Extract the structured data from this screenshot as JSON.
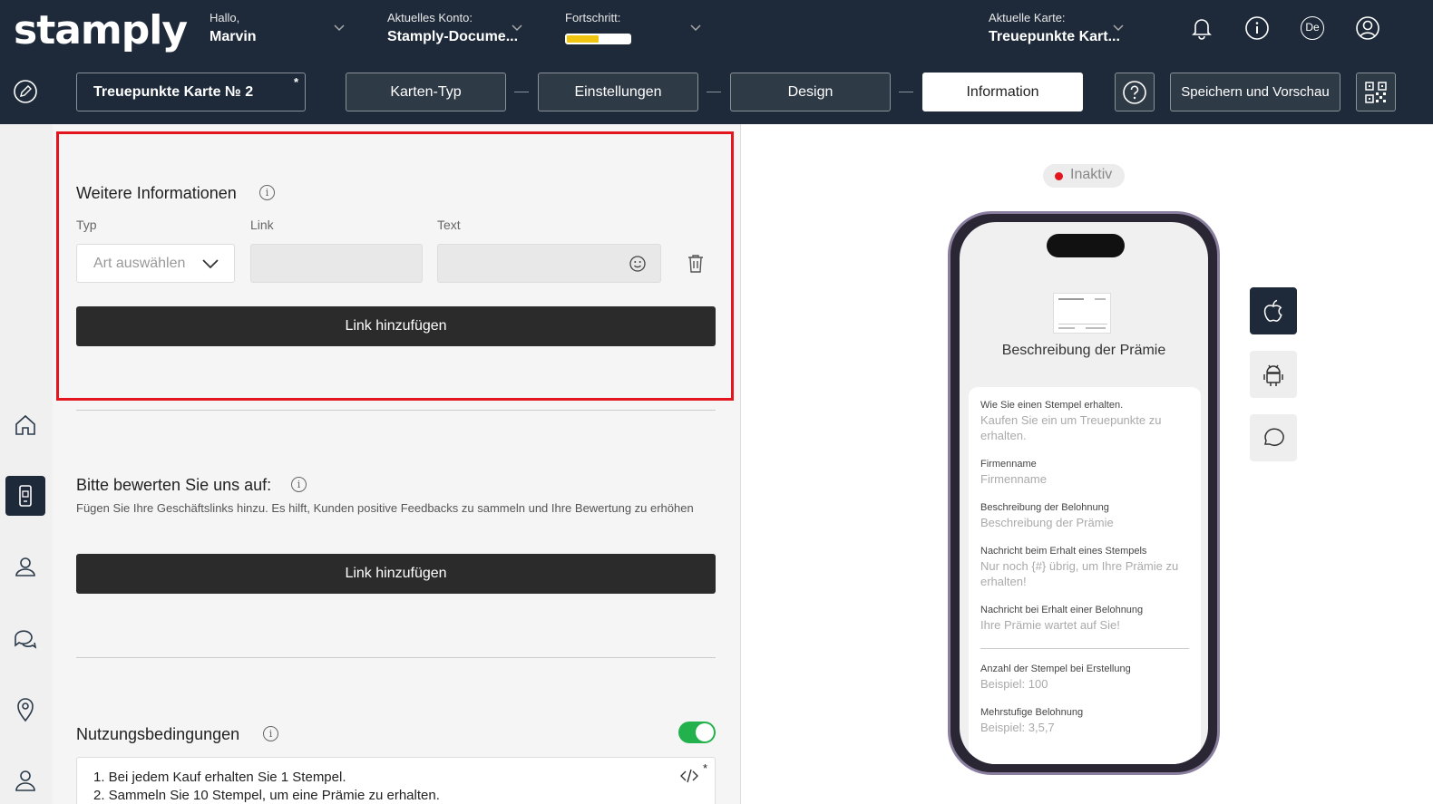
{
  "header": {
    "logo": "stamply",
    "greeting_label": "Hallo,",
    "greeting_name": "Marvin",
    "account_label": "Aktuelles Konto:",
    "account_value": "Stamply-Docume...",
    "progress_label": "Fortschritt:",
    "progress_fraction": 0.5,
    "card_label": "Aktuelle Karte:",
    "card_value": "Treuepunkte Kart...",
    "language": "De"
  },
  "toolbar": {
    "card_name": "Treuepunkte Karte № 2",
    "card_name_marker": "*",
    "steps": [
      "Karten-Typ",
      "Einstellungen",
      "Design",
      "Information"
    ],
    "active_step": "Information",
    "save_label": "Speichern und Vorschau"
  },
  "info_section": {
    "title": "Weitere Informationen",
    "info_glyph": "i",
    "type_label": "Typ",
    "link_label": "Link",
    "text_label": "Text",
    "type_placeholder": "Art auswählen",
    "add_link_label": "Link hinzufügen"
  },
  "review_section": {
    "title": "Bitte bewerten Sie uns auf:",
    "description": "Fügen Sie Ihre Geschäftslinks hinzu. Es hilft, Kunden positive Feedbacks zu sammeln und Ihre Bewertung zu erhöhen",
    "add_link_label": "Link hinzufügen"
  },
  "terms_section": {
    "title": "Nutzungsbedingungen",
    "enabled": true,
    "code_marker": "*",
    "lines": [
      "1. Bei jedem Kauf erhalten Sie 1 Stempel.",
      "2. Sammeln Sie 10 Stempel, um eine Prämie zu erhalten."
    ]
  },
  "preview": {
    "status": "Inaktiv",
    "title": "Beschreibung der Prämie",
    "fields": [
      {
        "label": "Wie Sie einen Stempel erhalten.",
        "value": "Kaufen Sie ein um Treuepunkte zu erhalten."
      },
      {
        "label": "Firmenname",
        "value": "Firmenname"
      },
      {
        "label": "Beschreibung der Belohnung",
        "value": "Beschreibung der Prämie"
      },
      {
        "label": "Nachricht beim Erhalt eines Stempels",
        "value": "Nur noch {#} übrig, um Ihre Prämie zu erhalten!"
      },
      {
        "label": "Nachricht bei Erhalt einer Belohnung",
        "value": "Ihre Prämie wartet auf Sie!"
      }
    ],
    "fields2": [
      {
        "label": "Anzahl der Stempel bei Erstellung",
        "value": "Beispiel: 100"
      },
      {
        "label": "Mehrstufige Belohnung",
        "value": "Beispiel: 3,5,7"
      }
    ]
  },
  "colors": {
    "header_bg": "#1e2a3a",
    "highlight": "#e3161f",
    "toggle_on": "#22b14c",
    "progress": "#f1c40f"
  }
}
